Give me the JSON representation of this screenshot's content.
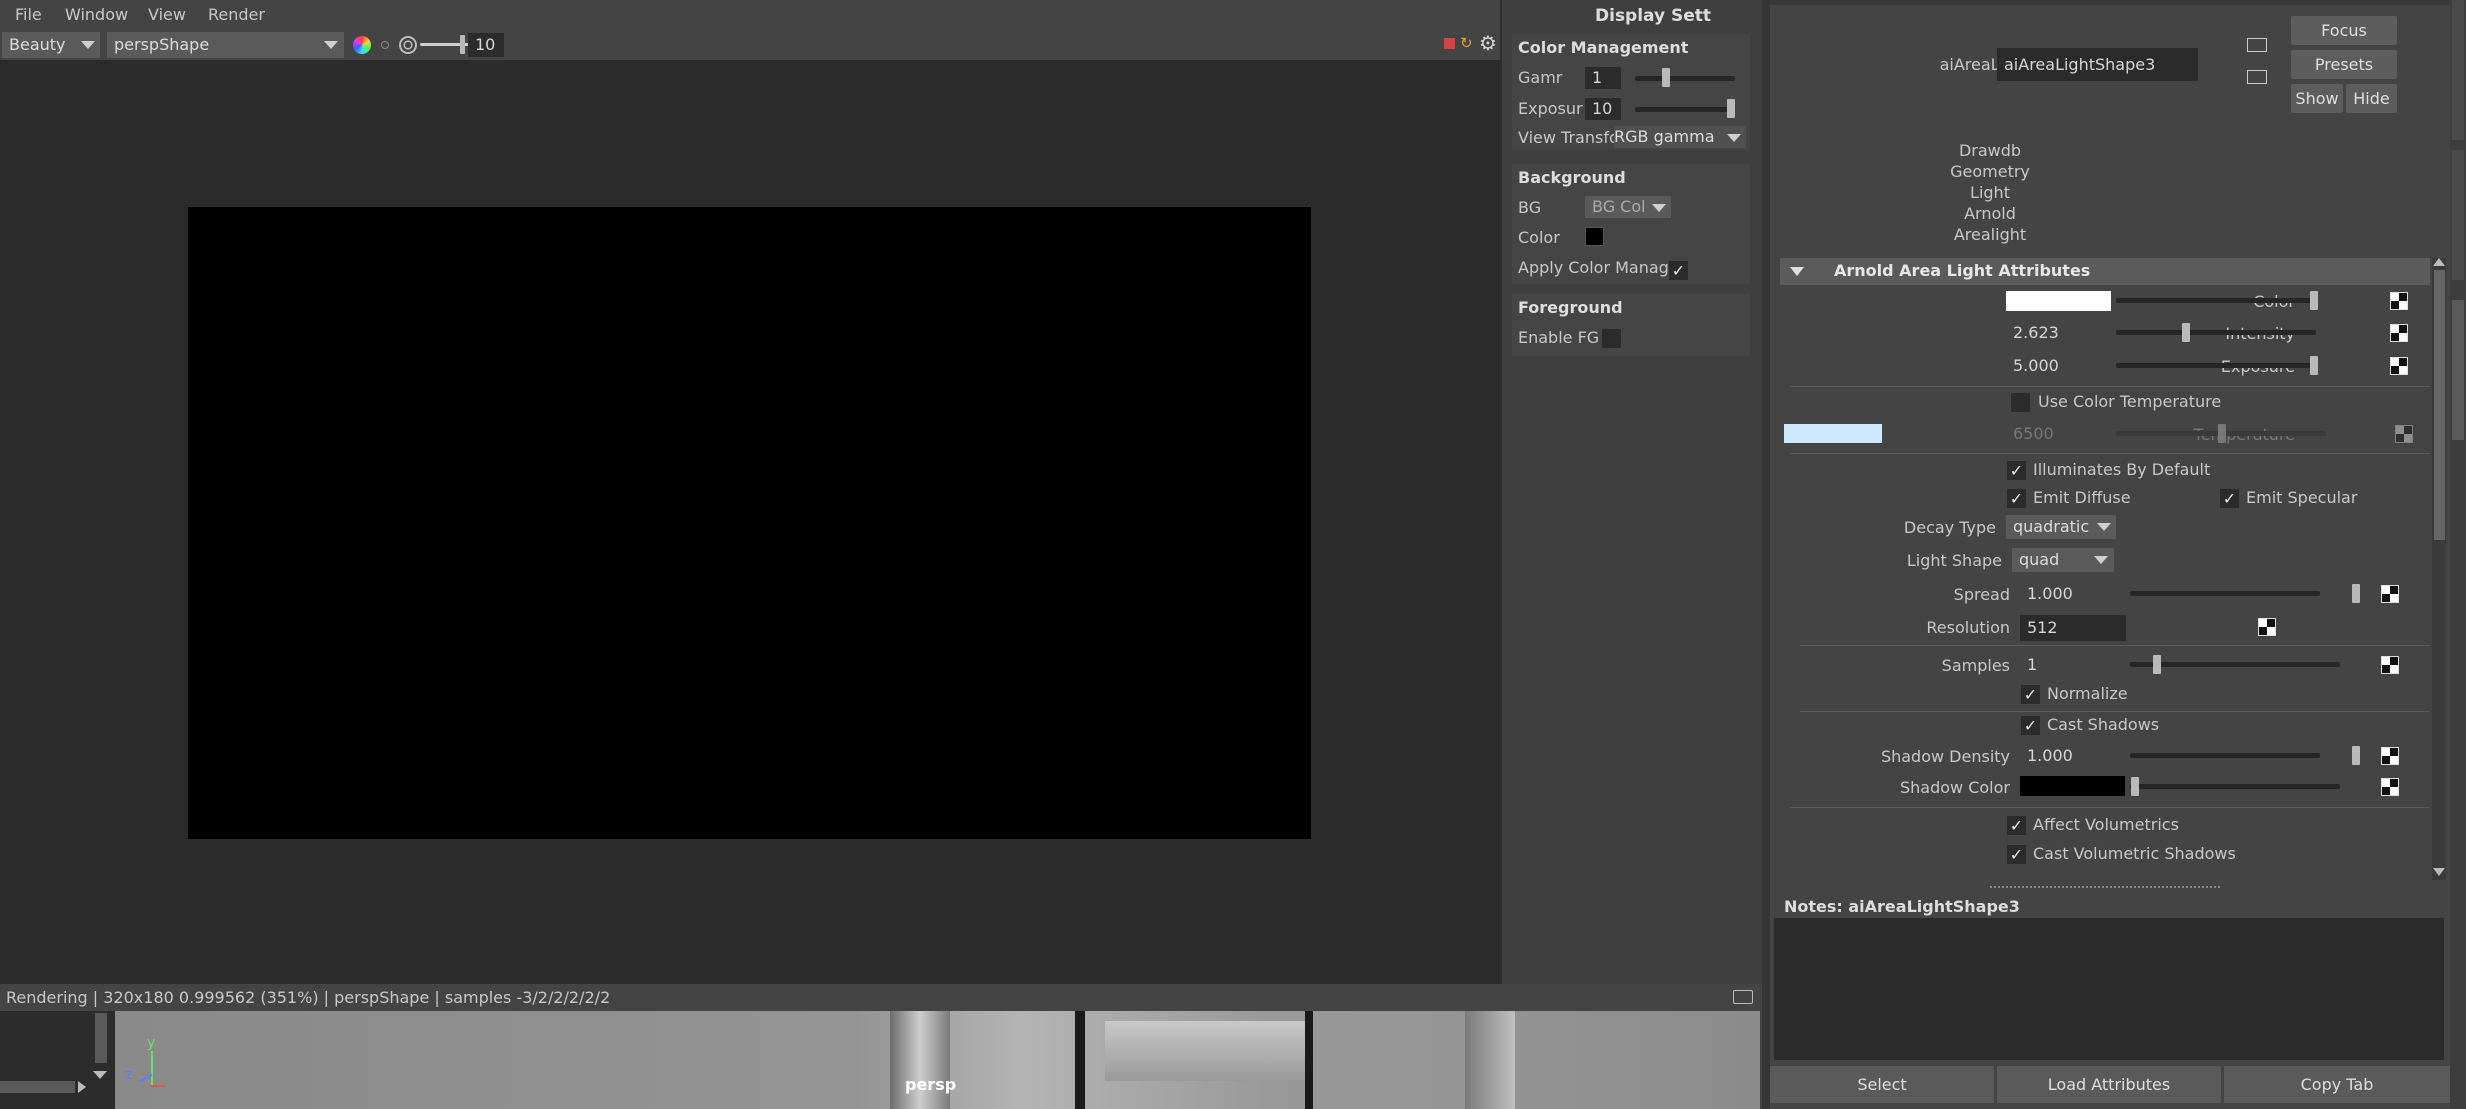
{
  "menu": [
    "File",
    "Window",
    "View",
    "Render"
  ],
  "toolbar": {
    "aov_select": "Beauty",
    "camera_select": "perspShape",
    "exposure_value": "10"
  },
  "display_settings": {
    "title": "Display Sett",
    "color_management": {
      "heading": "Color Management",
      "gamma_label": "Gamr",
      "gamma_value": "1",
      "exposure_label": "Exposur",
      "exposure_value": "10",
      "view_transform_label": "View Transfos",
      "view_transform_value": "RGB gamma"
    },
    "background": {
      "heading": "Background",
      "bg_label": "BG",
      "bg_value": "BG Col",
      "color_label": "Color",
      "apply_label": "Apply Color Manag"
    },
    "foreground": {
      "heading": "Foreground",
      "enable_label": "Enable FG"
    }
  },
  "status_bar": {
    "text": "Rendering | 320x180 0.999562 (351%) | perspShape  | samples -3/2/2/2/2/2"
  },
  "viewport": {
    "camera_label": "persp",
    "axis_y": "y",
    "axis_z": "z"
  },
  "attribute_editor": {
    "node_label": "aiAreaLight:",
    "node_name": "aiAreaLightShape3",
    "buttons": {
      "focus": "Focus",
      "presets": "Presets",
      "show": "Show",
      "hide": "Hide"
    },
    "categories": [
      "Drawdb",
      "Geometry",
      "Light",
      "Arnold",
      "Arealight"
    ],
    "section_title": "Arnold Area Light Attributes",
    "attrs": {
      "color_label": "Color",
      "intensity_label": "Intensity",
      "intensity_value": "2.623",
      "exposure_label": "Exposure",
      "exposure_value": "5.000",
      "use_color_temp_label": "Use Color Temperature",
      "temperature_label": "Temperature",
      "temperature_value": "6500",
      "illuminates_label": "Illuminates By Default",
      "emit_diffuse_label": "Emit Diffuse",
      "emit_specular_label": "Emit Specular",
      "decay_type_label": "Decay Type",
      "decay_type_value": "quadratic",
      "light_shape_label": "Light Shape",
      "light_shape_value": "quad",
      "spread_label": "Spread",
      "spread_value": "1.000",
      "resolution_label": "Resolution",
      "resolution_value": "512",
      "samples_label": "Samples",
      "samples_value": "1",
      "normalize_label": "Normalize",
      "cast_shadows_label": "Cast Shadows",
      "shadow_density_label": "Shadow Density",
      "shadow_density_value": "1.000",
      "shadow_color_label": "Shadow Color",
      "affect_volumetrics_label": "Affect Volumetrics",
      "cast_volumetric_shadows_label": "Cast Volumetric Shadows"
    },
    "notes_label": "Notes:  aiAreaLightShape3",
    "bottom_buttons": {
      "select": "Select",
      "load_attributes": "Load Attributes",
      "copy_tab": "Copy Tab"
    }
  },
  "colors": {
    "light_color": "#ffffff",
    "temperature_swatch": "#cde8ff",
    "shadow_color": "#000000",
    "bg_swatch": "#000000"
  }
}
